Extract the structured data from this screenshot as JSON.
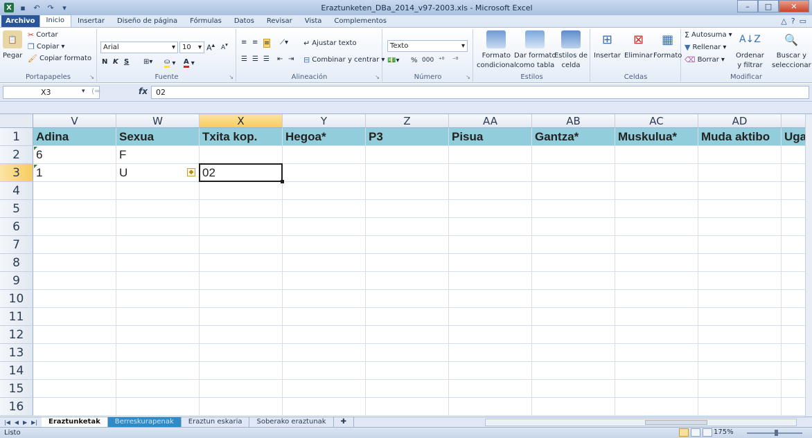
{
  "window": {
    "title": "Eraztunketen_DBa_2014_v97-2003.xls - Microsoft Excel",
    "minimize_icon": "minimize-icon",
    "maximize_icon": "maximize-icon",
    "close_icon": "close-icon"
  },
  "ribbon_tabs": [
    "Archivo",
    "Inicio",
    "Insertar",
    "Diseño de página",
    "Fórmulas",
    "Datos",
    "Revisar",
    "Vista",
    "Complementos"
  ],
  "active_tab": "Inicio",
  "clipboard": {
    "paste": "Pegar",
    "cut": "Cortar",
    "copy": "Copiar",
    "copy_format": "Copiar formato",
    "label": "Portapapeles"
  },
  "font": {
    "name": "Arial",
    "size": "10",
    "bold": "N",
    "italic": "K",
    "underline": "S",
    "label": "Fuente"
  },
  "alignment": {
    "wrap_text": "Ajustar texto",
    "merge_center": "Combinar y centrar",
    "label": "Alineación"
  },
  "number": {
    "format": "Texto",
    "percent": "%",
    "thousands": "000",
    "label": "Número"
  },
  "styles": {
    "conditional": [
      "Formato",
      "condicional"
    ],
    "as_table": [
      "Dar formato",
      "como tabla"
    ],
    "cell_styles": [
      "Estilos de",
      "celda"
    ],
    "label": "Estilos"
  },
  "cells": {
    "insert": "Insertar",
    "delete": "Eliminar",
    "format": "Formato",
    "label": "Celdas"
  },
  "editing": {
    "autosum": "Autosuma",
    "fill": "Rellenar",
    "clear": "Borrar",
    "sort": [
      "Ordenar",
      "y filtrar"
    ],
    "find": [
      "Buscar y",
      "seleccionar"
    ],
    "label": "Modificar"
  },
  "formula_bar": {
    "name_box": "X3",
    "fx": "fx",
    "value": "02"
  },
  "grid": {
    "columns": [
      "V",
      "W",
      "X",
      "Y",
      "Z",
      "AA",
      "AB",
      "AC",
      "AD"
    ],
    "selected_column": "X",
    "rows": [
      "1",
      "2",
      "3",
      "4",
      "5",
      "6",
      "7",
      "8",
      "9",
      "10",
      "11",
      "12",
      "13",
      "14",
      "15",
      "16"
    ],
    "selected_row": "3",
    "header_row": [
      "Adina",
      "Sexua",
      "Txita kop.",
      "Hegoa*",
      "P3",
      "Pisua",
      "Gantza*",
      "Muskulua*",
      "Muda aktibo",
      "Uga"
    ],
    "row2": [
      "6",
      "F",
      "",
      "",
      "",
      "",
      "",
      "",
      ""
    ],
    "row3": [
      "1",
      "U",
      "02",
      "",
      "",
      "",
      "",
      "",
      ""
    ],
    "header_fill": "#92cddc"
  },
  "sheets": [
    "Eraztunketak",
    "Berreskurapenak",
    "Eraztun eskaria",
    "Soberako eraztunak"
  ],
  "active_sheet": "Eraztunketak",
  "status": {
    "text": "Listo",
    "zoom": "175%"
  }
}
